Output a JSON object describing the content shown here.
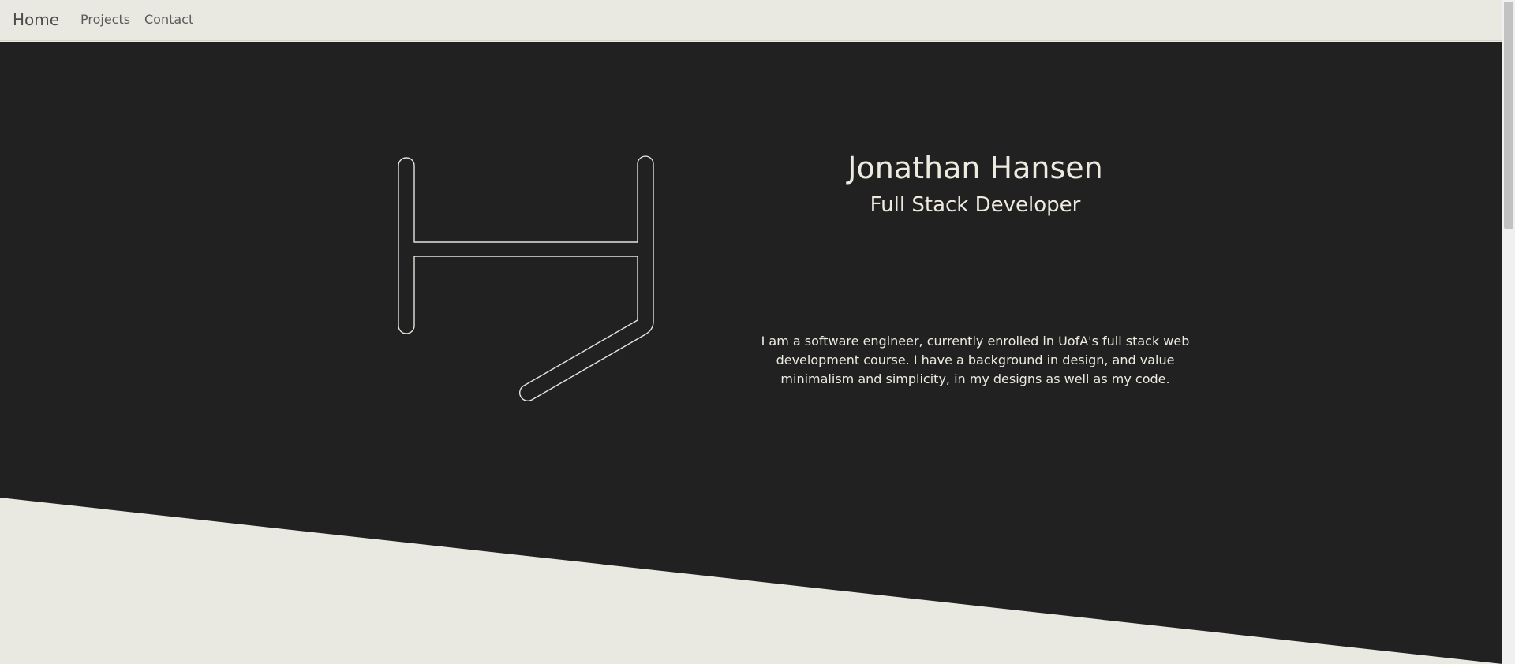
{
  "nav": {
    "brand": "Home",
    "links": [
      "Projects",
      "Contact"
    ]
  },
  "hero": {
    "name": "Jonathan Hansen",
    "role": "Full Stack Developer",
    "bio": "I am a software engineer, currently enrolled in UofA's full stack web development course. I have a background in design, and value minimalism and simplicity, in my designs as well as my code."
  },
  "colors": {
    "light_bg": "#e9e8e1",
    "dark_bg": "#212121",
    "light_text": "#eeeae0",
    "nav_text": "#5a5a5a"
  },
  "icons": {
    "logo": "jh-monogram-outline-logo"
  }
}
